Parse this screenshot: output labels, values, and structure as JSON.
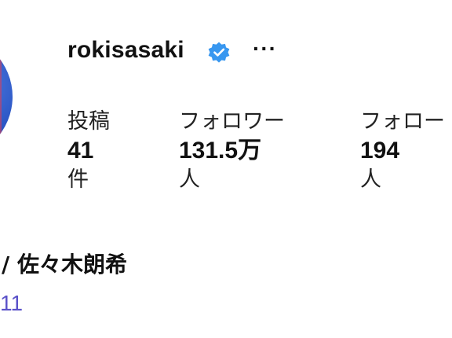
{
  "profile": {
    "username": "rokisasaki",
    "verified_icon": "verified-badge-icon",
    "more_icon": "more-options-icon",
    "more_label": "···",
    "display_name": "/ 佐々木朗希",
    "bio_link_fragment": "11"
  },
  "stats": [
    {
      "label": "投稿",
      "count": "41",
      "unit": "件"
    },
    {
      "label": "フォロワー",
      "count": "131.5万",
      "unit": "人"
    },
    {
      "label": "フォロー",
      "count": "194",
      "unit": "人"
    }
  ],
  "colors": {
    "verified_badge": "#3897f0",
    "link": "#5b52c9",
    "avatar": "#2a55c4"
  }
}
